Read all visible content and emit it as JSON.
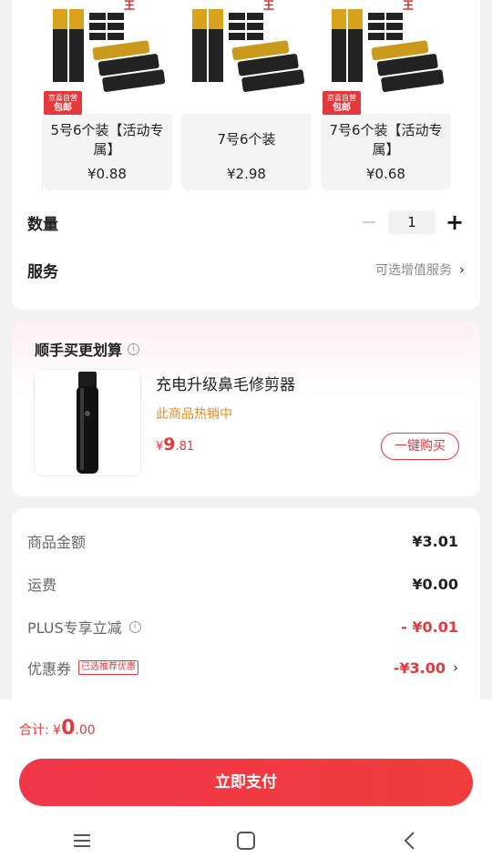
{
  "variants": [
    {
      "name": "5号6个装【活动专属】",
      "price": "¥0.88",
      "badge_top": "京喜自营",
      "badge_bottom": "包邮"
    },
    {
      "name": "7号6个装",
      "price": "¥2.98"
    },
    {
      "name": "7号6个装【活动专属】",
      "price": "¥0.68",
      "badge_top": "京喜自营",
      "badge_bottom": "包邮"
    }
  ],
  "quantity": {
    "label": "数量",
    "value": "1",
    "minus": "−",
    "plus": "+"
  },
  "service": {
    "label": "服务",
    "hint": "可选增值服务",
    "chevron": "›"
  },
  "bundle": {
    "title": "顺手买更划算",
    "info_icon": "i",
    "product_name": "充电升级鼻毛修剪器",
    "tag": "此商品热销中",
    "price_symbol": "¥",
    "price_int": "9",
    "price_dec": ".81",
    "buy_label": "一键购买"
  },
  "summary": {
    "goods_label": "商品金额",
    "goods_value": "¥3.01",
    "shipping_label": "运费",
    "shipping_value": "¥0.00",
    "plus_label": "PLUS专享立减",
    "plus_value": "- ¥0.01",
    "coupon_label": "优惠券",
    "coupon_tag": "已选推荐优惠",
    "coupon_value": "-¥3.00"
  },
  "footer": {
    "total_label": "合计: ",
    "total_symbol": "¥",
    "total_int": "0",
    "total_dec": ".00",
    "pay_label": "立即支付"
  },
  "colors": {
    "accent": "#e4393c",
    "tag_orange": "#e88a1a",
    "background": "#f2f2f2"
  },
  "icons": [
    "info-icon",
    "chevron-right-icon",
    "menu-icon",
    "home-icon",
    "back-icon"
  ]
}
